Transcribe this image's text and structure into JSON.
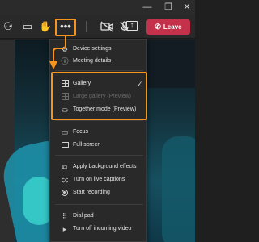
{
  "window": {
    "minimize_icon": "minimize-icon",
    "maximize_icon": "restore-icon",
    "close_icon": "close-icon",
    "minimize_glyph": "—",
    "maximize_glyph": "❐",
    "close_glyph": "✕"
  },
  "toolbar": {
    "icons": {
      "people": "⚇",
      "chat": "▭",
      "hand": "✋",
      "more": "•••",
      "camera": "⊘",
      "mic": "🎙",
      "share": "↑"
    },
    "leave_label": "Leave",
    "leave_glyph": "✆",
    "leave_color": "#c4314b"
  },
  "highlight_color": "#f7941d",
  "menu": {
    "items": [
      {
        "id": "device",
        "label": "Device settings",
        "icon": "gear-icon",
        "glyph": "⚙"
      },
      {
        "id": "meeting",
        "label": "Meeting details",
        "icon": "info-icon",
        "glyph": "ⓘ"
      },
      {
        "id": "gallery",
        "label": "Gallery",
        "icon": "grid-icon",
        "checked": true,
        "check_glyph": "✓"
      },
      {
        "id": "large",
        "label": "Large gallery (Preview)",
        "icon": "large-grid-icon",
        "disabled": true
      },
      {
        "id": "together",
        "label": "Together mode (Preview)",
        "icon": "together-icon",
        "glyph": "⛀"
      },
      {
        "id": "focus",
        "label": "Focus",
        "icon": "focus-icon",
        "glyph": "▭"
      },
      {
        "id": "fullscreen",
        "label": "Full screen",
        "icon": "fullscreen-icon"
      },
      {
        "id": "background",
        "label": "Apply background effects",
        "icon": "background-effects-icon",
        "glyph": "⧉"
      },
      {
        "id": "captions",
        "label": "Turn on live captions",
        "icon": "captions-icon",
        "glyph": "㏄"
      },
      {
        "id": "record",
        "label": "Start recording",
        "icon": "record-icon"
      },
      {
        "id": "dialpad",
        "label": "Dial pad",
        "icon": "dialpad-icon",
        "glyph": "⠿"
      },
      {
        "id": "video",
        "label": "Turn off incoming video",
        "icon": "video-off-icon",
        "glyph": "▸"
      }
    ]
  }
}
